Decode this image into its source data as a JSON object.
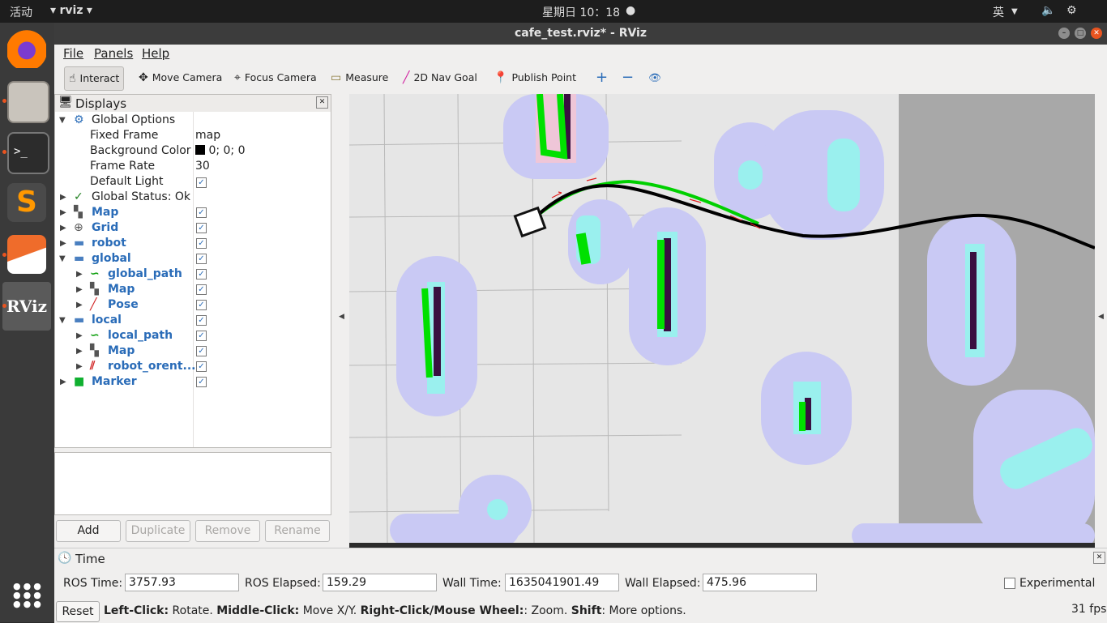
{
  "topbar": {
    "activities": "活动",
    "app_name": "rviz",
    "clock": "星期日 10：18",
    "ime": "英"
  },
  "window": {
    "title": "cafe_test.rviz* - RViz"
  },
  "menu": {
    "file": "File",
    "panels": "Panels",
    "help": "Help"
  },
  "toolbar": {
    "interact": "Interact",
    "move_camera": "Move Camera",
    "focus_camera": "Focus Camera",
    "measure": "Measure",
    "nav_goal": "2D Nav Goal",
    "publish_point": "Publish Point"
  },
  "displays": {
    "title": "Displays",
    "global_options": "Global Options",
    "fixed_frame_label": "Fixed Frame",
    "fixed_frame_value": "map",
    "bg_color_label": "Background Color",
    "bg_color_value": "0; 0; 0",
    "frame_rate_label": "Frame Rate",
    "frame_rate_value": "30",
    "default_light_label": "Default Light",
    "global_status": "Global Status: Ok",
    "items": [
      "Map",
      "Grid",
      "robot",
      "global",
      "global_path",
      "Map",
      "Pose",
      "local",
      "local_path",
      "Map",
      "robot_orent...",
      "Marker"
    ]
  },
  "panel_buttons": {
    "add": "Add",
    "duplicate": "Duplicate",
    "remove": "Remove",
    "rename": "Rename"
  },
  "time": {
    "title": "Time",
    "ros_time_label": "ROS Time:",
    "ros_time": "3757.93",
    "ros_elapsed_label": "ROS Elapsed:",
    "ros_elapsed": "159.29",
    "wall_time_label": "Wall Time:",
    "wall_time": "1635041901.49",
    "wall_elapsed_label": "Wall Elapsed:",
    "wall_elapsed": "475.96",
    "experimental": "Experimental"
  },
  "status": {
    "reset": "Reset",
    "left_click": "Left-Click:",
    "rotate": " Rotate. ",
    "middle_click": "Middle-Click:",
    "move": " Move X/Y. ",
    "right_click": "Right-Click/Mouse Wheel:",
    "zoom": ": Zoom. ",
    "shift": "Shift",
    "more": ": More options.",
    "fps": "31 fps"
  },
  "colors": {
    "accent": "#e95420",
    "path_global": "#00d000",
    "path_local": "#000000",
    "costmap": "#c8c8f5",
    "inflation": "#9ff3ee"
  }
}
